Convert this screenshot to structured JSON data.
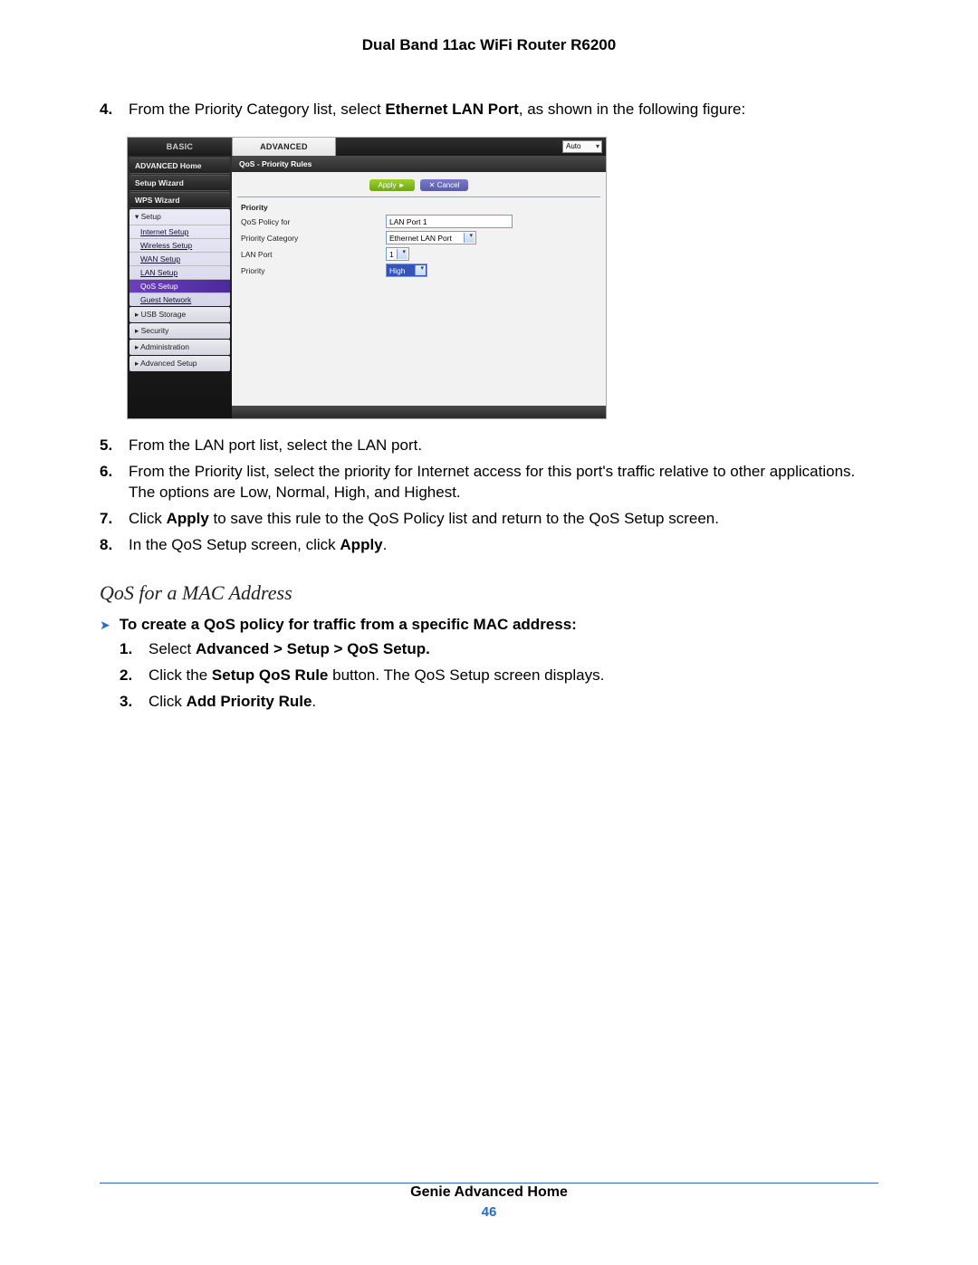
{
  "header": {
    "product_title": "Dual Band 11ac WiFi Router R6200"
  },
  "steps_a": [
    {
      "n": "4.",
      "pre": "From the Priority Category list, select ",
      "bold": "Ethernet LAN Port",
      "post": ", as shown in the following figure:"
    }
  ],
  "steps_b": [
    {
      "n": "5.",
      "text": "From the LAN port list, select the LAN port."
    },
    {
      "n": "6.",
      "text": "From the Priority list, select the priority for Internet access for this port's traffic relative to other applications. The options are Low, Normal, High, and Highest."
    },
    {
      "n": "7.",
      "pre": "Click ",
      "bold": "Apply",
      "post": " to save this rule to the QoS Policy list and return to the QoS Setup screen."
    },
    {
      "n": "8.",
      "pre": "In the QoS Setup screen, click ",
      "bold": "Apply",
      "post": "."
    }
  ],
  "sub_heading": "QoS for a MAC Address",
  "procedure": {
    "title": "To create a QoS policy for traffic from a specific MAC address:",
    "steps": [
      {
        "n": "1.",
        "pre": "Select ",
        "bold": "Advanced > Setup > QoS Setup.",
        "post": ""
      },
      {
        "n": "2.",
        "pre": "Click the ",
        "bold": "Setup QoS Rule",
        "post": " button. The QoS Setup screen displays."
      },
      {
        "n": "3.",
        "pre": "Click ",
        "bold": "Add Priority Rule",
        "post": "."
      }
    ]
  },
  "screenshot": {
    "tabs": {
      "basic": "BASIC",
      "advanced": "ADVANCED",
      "auto": "Auto"
    },
    "sidebar": {
      "top": [
        "ADVANCED Home",
        "Setup Wizard",
        "WPS Wizard"
      ],
      "setup_header": "▾ Setup",
      "setup_items": [
        "Internet Setup",
        "Wireless Setup",
        "WAN Setup",
        "LAN Setup",
        "QoS Setup",
        "Guest Network"
      ],
      "active_index": 4,
      "collapsed": [
        "▸ USB Storage",
        "▸ Security",
        "▸ Administration",
        "▸ Advanced Setup"
      ]
    },
    "breadcrumb": "QoS - Priority Rules",
    "buttons": {
      "apply": "Apply ►",
      "cancel": "✕ Cancel"
    },
    "section_label": "Priority",
    "form": {
      "policy_for": {
        "label": "QoS Policy for",
        "value": "LAN Port 1"
      },
      "category": {
        "label": "Priority Category",
        "value": "Ethernet LAN Port"
      },
      "lan_port": {
        "label": "LAN Port",
        "value": "1"
      },
      "priority": {
        "label": "Priority",
        "value": "High"
      }
    }
  },
  "footer": {
    "label": "Genie Advanced Home",
    "page": "46"
  }
}
